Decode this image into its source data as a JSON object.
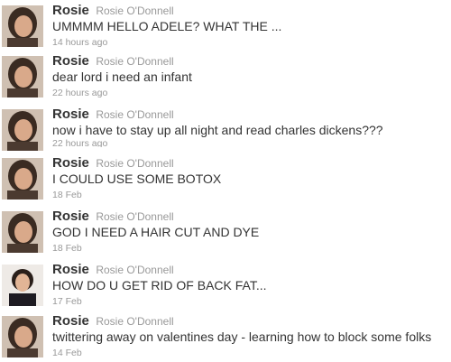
{
  "icons": {
    "avatar_default": "avatar-photo-icon",
    "avatar_alt": "avatar-photo-icon"
  },
  "tweets": [
    {
      "username": "Rosie",
      "fullname": "Rosie O'Donnell",
      "text": "UMMMM HELLO ADELE? WHAT THE ...",
      "time": "14 hours ago"
    },
    {
      "username": "Rosie",
      "fullname": "Rosie O'Donnell",
      "text": "dear lord i need an infant",
      "time": "22 hours ago"
    },
    {
      "username": "Rosie",
      "fullname": "Rosie O'Donnell",
      "text": "now i have to stay up all night and read charles dickens???",
      "time": "22 hours ago"
    },
    {
      "username": "Rosie",
      "fullname": "Rosie O'Donnell",
      "text": "I COULD USE SOME BOTOX",
      "time": "18 Feb"
    },
    {
      "username": "Rosie",
      "fullname": "Rosie O'Donnell",
      "text": "GOD I NEED A HAIR CUT AND DYE",
      "time": "18 Feb"
    },
    {
      "username": "Rosie",
      "fullname": "Rosie O'Donnell",
      "text": "HOW DO U GET RID OF BACK FAT...",
      "time": "17 Feb"
    },
    {
      "username": "Rosie",
      "fullname": "Rosie O'Donnell",
      "text": "twittering away on valentines day - learning how to block some folks",
      "time": "14 Feb"
    }
  ]
}
